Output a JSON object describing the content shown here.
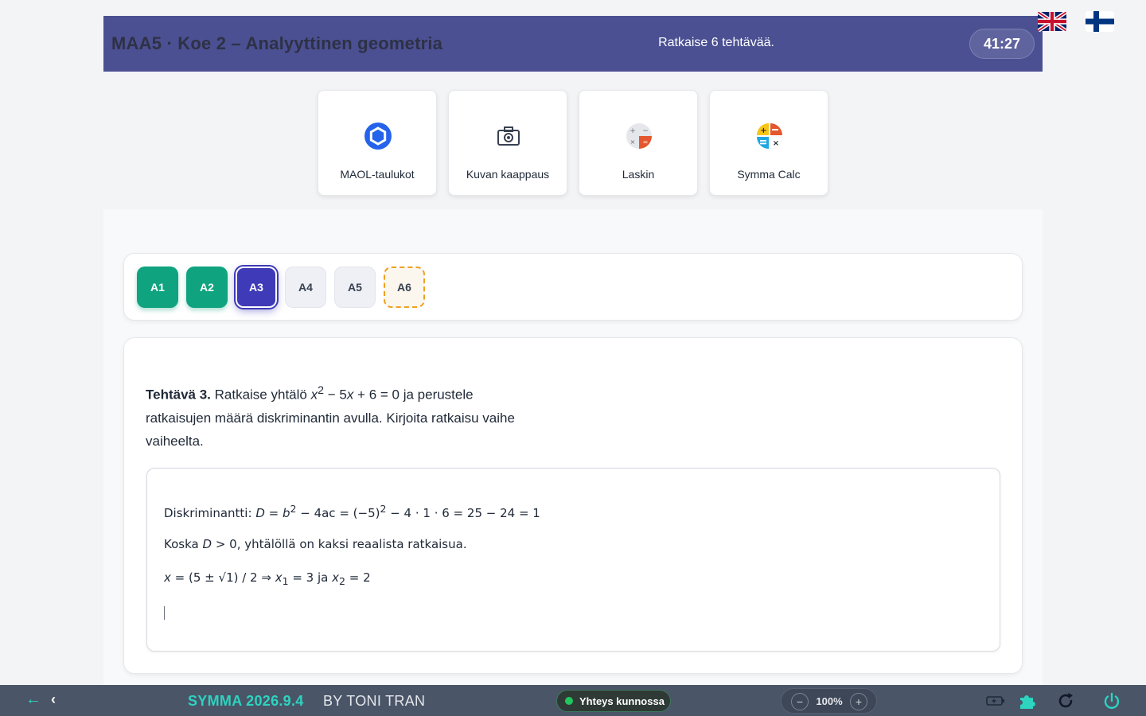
{
  "header": {
    "title": "MAA5 · Koe 2 – Analyyttinen geometria",
    "instruction": "Ratkaise 6 tehtävää.",
    "timer": "41:27"
  },
  "languages": [
    {
      "code": "en",
      "icon": "uk-flag-icon"
    },
    {
      "code": "fi",
      "icon": "finland-flag-icon"
    }
  ],
  "tools": [
    {
      "label": "MAOL-taulukot",
      "icon": "hexagon-icon"
    },
    {
      "label": "Kuvan kaappaus",
      "icon": "camera-icon"
    },
    {
      "label": "Laskin",
      "icon": "calculator-icon"
    },
    {
      "label": "Symma Calc",
      "icon": "symma-calc-icon"
    }
  ],
  "tabs": [
    {
      "label": "A1",
      "state": "done"
    },
    {
      "label": "A2",
      "state": "done"
    },
    {
      "label": "A3",
      "state": "active"
    },
    {
      "label": "A4",
      "state": "todo"
    },
    {
      "label": "A5",
      "state": "todo"
    },
    {
      "label": "A6",
      "state": "flagged"
    }
  ],
  "task": {
    "number_label": "Tehtävä 3.",
    "text_before": "Ratkaise yhtälö",
    "equation_var": "x",
    "equation_exp": "2",
    "equation_rest": "− 5",
    "equation_var2": "x",
    "equation_tail": "+ 6 = 0 ja perustele ratkaisujen määrä diskriminantin avulla. Kirjoita ratkaisu vaihe vaiheelta."
  },
  "answer": {
    "line1_prefix": "Diskriminantti:",
    "line1_formula_a": "D = b",
    "line1_exp1": "2",
    "line1_formula_b": "− 4ac = (−5)",
    "line1_exp2": "2",
    "line1_formula_c": "− 4 · 1 · 6 = 25 − 24 = 1",
    "line2_a": "Koska",
    "line2_b": "D",
    "line2_c": "> 0, yhtälöllä on kaksi reaalista ratkaisua.",
    "line3_a": "x",
    "line3_b": "= (5 ± √1) / 2  ⇒ ",
    "line3_c": "x",
    "line3_sub1": "1",
    "line3_d": "= 3  ja ",
    "line3_e": "x",
    "line3_sub2": "2",
    "line3_f": "= 2"
  },
  "footer": {
    "brand": "SYMMA 2026.9.4",
    "by": "BY TONI TRAN",
    "status": "Yhteys kunnossa",
    "zoom_minus": "−",
    "zoom": "100%",
    "zoom_plus": "+",
    "back_icon": "←",
    "prev_icon": "‹"
  },
  "colors": {
    "header_bg": "#4b5092",
    "done": "#10a37f",
    "active": "#3f3ab8",
    "flag_border": "#f0a020",
    "brand": "#2dd4bf",
    "footer_bg": "#4a5568"
  }
}
